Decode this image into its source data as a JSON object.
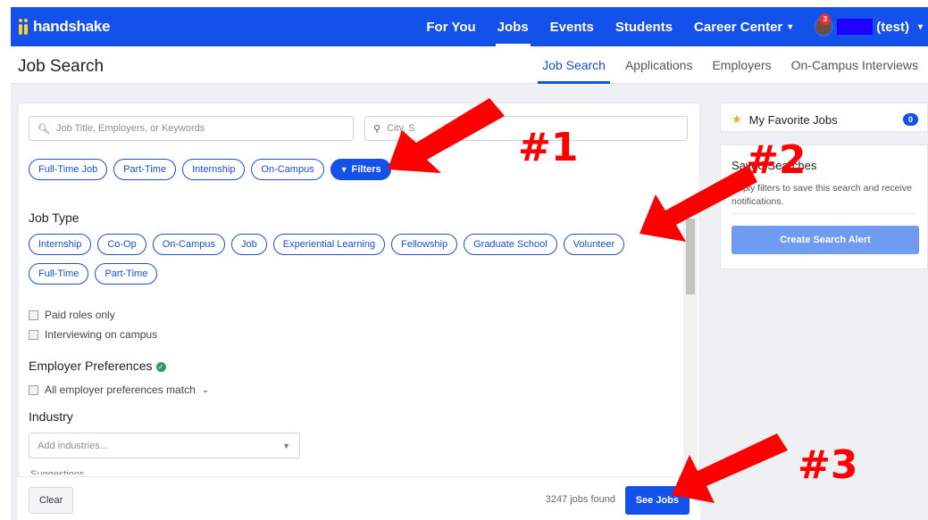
{
  "brand": {
    "name": "handshake"
  },
  "nav": {
    "items": [
      {
        "label": "For You",
        "active": false
      },
      {
        "label": "Jobs",
        "active": true
      },
      {
        "label": "Events",
        "active": false
      },
      {
        "label": "Students",
        "active": false
      },
      {
        "label": "Career Center",
        "active": false
      }
    ],
    "notification_count": "3",
    "user_label": "(test)"
  },
  "subnav": {
    "page_title": "Job Search",
    "tabs": [
      {
        "label": "Job Search",
        "active": true
      },
      {
        "label": "Applications",
        "active": false
      },
      {
        "label": "Employers",
        "active": false
      },
      {
        "label": "On-Campus Interviews",
        "active": false
      }
    ]
  },
  "search": {
    "keyword_placeholder": "Job Title, Employers, or Keywords",
    "location_placeholder": "City, S"
  },
  "quick_filters": [
    "Full-Time Job",
    "Part-Time",
    "Internship",
    "On-Campus"
  ],
  "filters_button": "Filters",
  "job_type": {
    "title": "Job Type",
    "pills": [
      "Internship",
      "Co-Op",
      "On-Campus",
      "Job",
      "Experiential Learning",
      "Fellowship",
      "Graduate School",
      "Volunteer",
      "Full-Time",
      "Part-Time"
    ]
  },
  "checkboxes": [
    "Paid roles only",
    "Interviewing on campus"
  ],
  "employer_prefs": {
    "title": "Employer Preferences",
    "checkbox": "All employer preferences match"
  },
  "industry": {
    "title": "Industry",
    "placeholder": "Add industries...",
    "suggestions_label": "Suggestions"
  },
  "footer": {
    "clear_label": "Clear",
    "jobs_found": "3247 jobs found",
    "see_jobs_label": "See Jobs"
  },
  "favorites": {
    "title": "My Favorite Jobs",
    "count": "0"
  },
  "saved_searches": {
    "title": "Saved Searches",
    "description": "Apply filters to save this search and receive notifications.",
    "button": "Create Search Alert"
  },
  "annotations": [
    "#1",
    "#2",
    "#3"
  ],
  "colors": {
    "brand_blue": "#1451ea",
    "logo_yellow": "#ffd129",
    "annotation_red": "#ff0000"
  }
}
